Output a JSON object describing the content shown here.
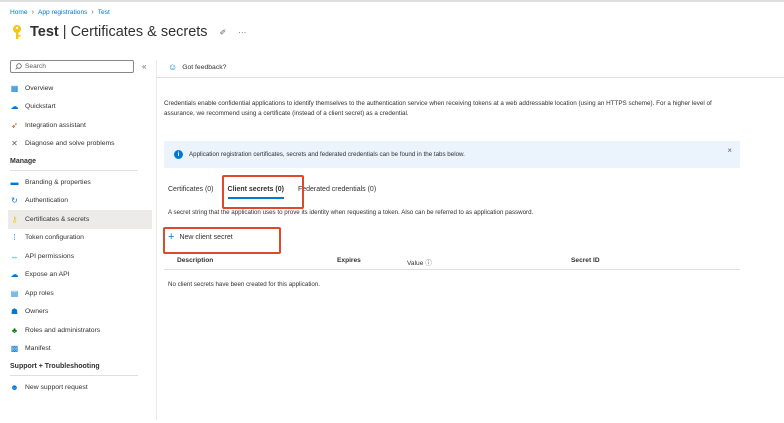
{
  "breadcrumb": [
    "Home",
    "App registrations",
    "Test"
  ],
  "header": {
    "title_bold": "Test",
    "title_rest": " | Certificates & secrets"
  },
  "sidebar": {
    "search_placeholder": "Search",
    "items_top": [
      {
        "label": "Overview",
        "icon": "grid-icon",
        "color": "#0078d4"
      },
      {
        "label": "Quickstart",
        "icon": "cloud-icon",
        "color": "#0078d4"
      },
      {
        "label": "Integration assistant",
        "icon": "rocket-icon",
        "color": "#d83b01"
      },
      {
        "label": "Diagnose and solve problems",
        "icon": "wrench-icon",
        "color": "#605e5c"
      }
    ],
    "section_manage": "Manage",
    "items_manage": [
      {
        "label": "Branding & properties",
        "icon": "branding-icon",
        "color": "#0078d4"
      },
      {
        "label": "Authentication",
        "icon": "authentication-icon",
        "color": "#0078d4"
      },
      {
        "label": "Certificates & secrets",
        "icon": "key-icon",
        "color": "#f2c811",
        "active": true
      },
      {
        "label": "Token configuration",
        "icon": "token-icon",
        "color": "#0078d4"
      },
      {
        "label": "API permissions",
        "icon": "api-permissions-icon",
        "color": "#00b294"
      },
      {
        "label": "Expose an API",
        "icon": "cloud-icon",
        "color": "#0078d4"
      },
      {
        "label": "App roles",
        "icon": "app-roles-icon",
        "color": "#0078d4"
      },
      {
        "label": "Owners",
        "icon": "owners-icon",
        "color": "#0078d4"
      },
      {
        "label": "Roles and administrators",
        "icon": "roles-icon",
        "color": "#107c10"
      },
      {
        "label": "Manifest",
        "icon": "manifest-icon",
        "color": "#0078d4"
      }
    ],
    "section_support": "Support + Troubleshooting",
    "items_support": [
      {
        "label": "New support request",
        "icon": "support-icon",
        "color": "#0078d4"
      }
    ]
  },
  "main": {
    "feedback": "Got feedback?",
    "description": "Credentials enable confidential applications to identify themselves to the authentication service when receiving tokens at a web addressable location (using an HTTPS scheme). For a higher level of assurance, we recommend using a certificate (instead of a client secret) as a credential.",
    "info": "Application registration certificates, secrets and federated credentials can be found in the tabs below.",
    "tabs": [
      "Certificates (0)",
      "Client secrets (0)",
      "Federated credentials (0)"
    ],
    "secret_desc": "A secret string that the application uses to prove its identity when requesting a token. Also can be referred to as application password.",
    "new_button": "New client secret",
    "columns": [
      "Description",
      "Expires",
      "Value",
      "Secret ID"
    ],
    "empty": "No client secrets have been created for this application."
  },
  "colors": {
    "accent": "#0078d4",
    "highlight": "#e0482b"
  }
}
